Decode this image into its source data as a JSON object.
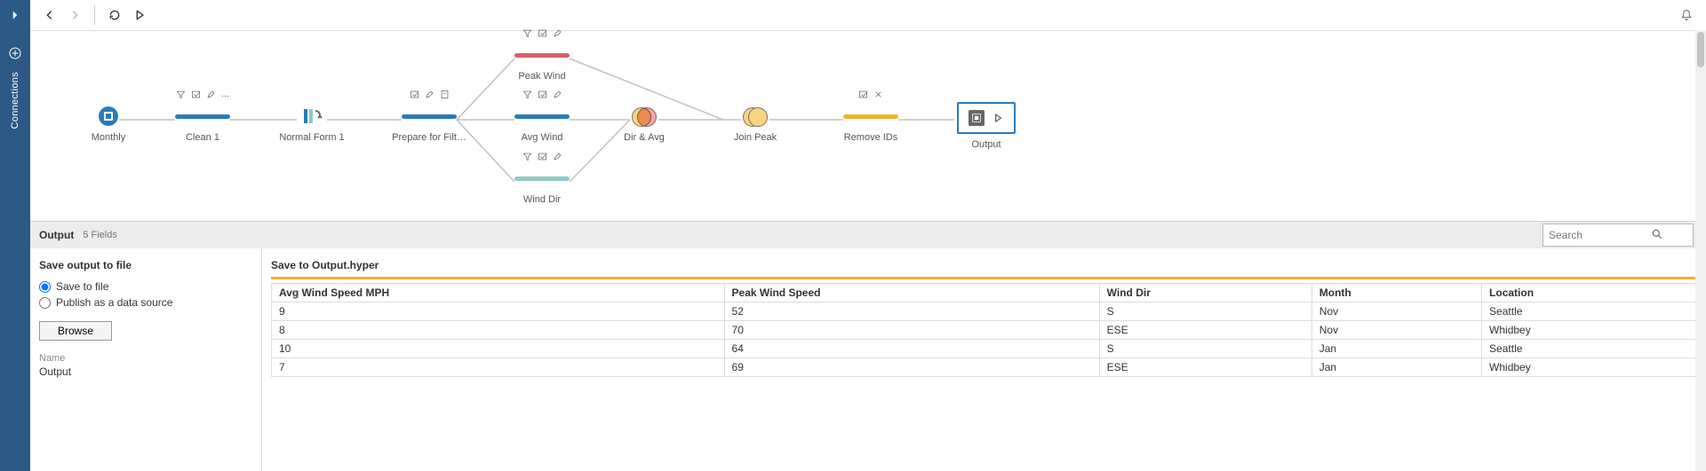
{
  "sidebar": {
    "label": "Connections"
  },
  "toolbar": {},
  "flow": {
    "nodes": {
      "monthly": {
        "label": "Monthly"
      },
      "clean1": {
        "label": "Clean 1"
      },
      "normal": {
        "label": "Normal Form 1"
      },
      "prepare": {
        "label": "Prepare for Filt…"
      },
      "peak": {
        "label": "Peak Wind"
      },
      "avg": {
        "label": "Avg Wind"
      },
      "dir": {
        "label": "Wind Dir"
      },
      "diravg": {
        "label": "Dir & Avg"
      },
      "joinpeak": {
        "label": "Join Peak"
      },
      "removeids": {
        "label": "Remove IDs"
      },
      "output": {
        "label": "Output"
      }
    }
  },
  "bottom": {
    "title": "Output",
    "fields_meta": "5 Fields",
    "search_placeholder": "Search",
    "save_panel": {
      "heading": "Save output to file",
      "opt_file": "Save to file",
      "opt_publish": "Publish as a data source",
      "browse": "Browse",
      "name_label": "Name",
      "name_value": "Output"
    },
    "preview": {
      "heading": "Save to Output.hyper",
      "columns": [
        "Avg Wind Speed MPH",
        "Peak Wind Speed",
        "Wind Dir",
        "Month",
        "Location"
      ],
      "rows": [
        [
          "9",
          "52",
          "S",
          "Nov",
          "Seattle"
        ],
        [
          "8",
          "70",
          "ESE",
          "Nov",
          "Whidbey"
        ],
        [
          "10",
          "64",
          "S",
          "Jan",
          "Seattle"
        ],
        [
          "7",
          "69",
          "ESE",
          "Jan",
          "Whidbey"
        ]
      ]
    }
  }
}
